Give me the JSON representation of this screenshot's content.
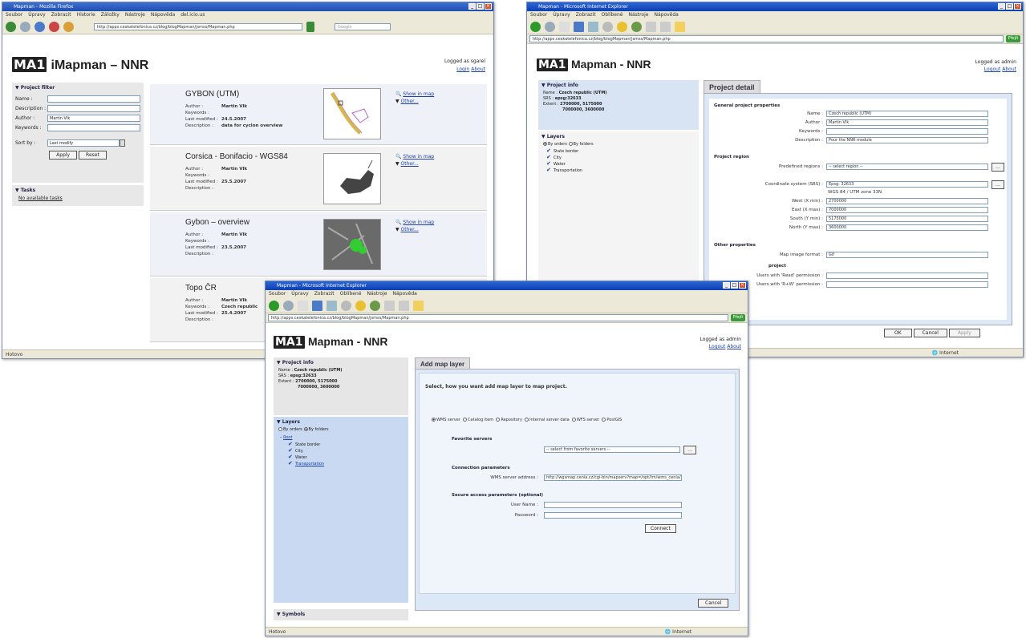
{
  "win1": {
    "title": "Mapman - Mozilla Firefox",
    "menu": [
      "Soubor",
      "Úpravy",
      "Zobrazit",
      "Historie",
      "Záložky",
      "Nástroje",
      "Nápověda",
      "del.icio.us"
    ],
    "address": "http://apps.ceskatelefonica.cz/blog/blogMapman/jsmss/Mapman.php",
    "search_placeholder": "Google",
    "app_title": "iMapman – NNR",
    "logo": "MA1",
    "logged_as": "Logged as  sgarel",
    "login": "Login",
    "about": "About",
    "filter": {
      "header": "Project filter",
      "name_label": "Name :",
      "description_label": "Description :",
      "author_label": "Author :",
      "author_value": "Martin Vlk",
      "keywords_label": "Keywords :",
      "sortby_label": "Sort by :",
      "sortby_value": "Last modify",
      "apply": "Apply",
      "reset": "Reset"
    },
    "tasks": {
      "header": "Tasks",
      "none": "No available tasks"
    },
    "projects": [
      {
        "title": "GYBON (UTM)",
        "author": "Martin Vlk",
        "keywords": "",
        "modified": "24.5.2007",
        "description": "data for cyclon overview"
      },
      {
        "title": "Corsica - Bonifacio - WGS84",
        "author": "Martin Vlk",
        "keywords": "",
        "modified": "25.5.2007",
        "description": ""
      },
      {
        "title": "Gybon – overview",
        "author": "Martin Vlk",
        "keywords": "",
        "modified": "23.5.2007",
        "description": ""
      },
      {
        "title": "Topo ČR",
        "author": "Martin Vlk",
        "keywords": "Czech republic",
        "modified": "25.4.2007",
        "description": ""
      }
    ],
    "meta_labels": {
      "author": "Author :",
      "keywords": "Keywords :",
      "modified": "Last modified :",
      "description": "Description :"
    },
    "show_map": "Show in map",
    "other": "Other...",
    "status": "Hotovo"
  },
  "win2": {
    "title": "Mapman - Microsoft Internet Explorer",
    "menu": [
      "Soubor",
      "Úpravy",
      "Zobrazit",
      "Oblíbené",
      "Nástroje",
      "Nápověda"
    ],
    "address": "http://apps.ceskatelefonica.cz/blog/blogMapman/jsmss/Mapman.php",
    "go": "Přejít",
    "app_title": "Mapman - NNR",
    "logo": "MA1",
    "logged_as": "Logged as  admin",
    "logout": "Logout",
    "about": "About",
    "info": {
      "header": "Project info",
      "name_label": "Name :",
      "name_value": "Czech republic (UTM)",
      "srs_label": "SRS :",
      "srs_value": "epsg:32633",
      "extent_label": "Extent :",
      "extent_value1": "2700000, 5175000",
      "extent_value2": "7000000, 3600000"
    },
    "layers": {
      "header": "Layers",
      "by_orders": "By orders",
      "by_folders": "By folders",
      "items": [
        "State border",
        "City",
        "Water",
        "Transportation"
      ]
    },
    "tab": "Project detail",
    "general": "General project properties",
    "fields": {
      "name_label": "Name :",
      "name_value": "Czech republic (UTM)",
      "author_label": "Author :",
      "author_value": "Martin Vlk",
      "keywords_label": "Keywords :",
      "keywords_value": "",
      "description_label": "Description :",
      "description_value": "Pour the NNR module"
    },
    "region": {
      "header": "Project region",
      "predefined_label": "Predefined regions :",
      "predefined_value": "-- select region --",
      "coord_label": "Coordinate system (SRS) :",
      "coord_value": "Epsg: 32633",
      "coord_desc": "WGS 84 / UTM zone 33N",
      "west_label": "West (X min) :",
      "west_value": "2700000",
      "east_label": "East (X max) :",
      "east_value": "7000000",
      "south_label": "South (Y min) :",
      "south_value": "5175000",
      "north_label": "North (Y max) :",
      "north_value": "3600000"
    },
    "other": {
      "header": "Other properties",
      "format_label": "Map image format :",
      "format_value": "Gif",
      "access_header": "project",
      "read_label": "Users with 'Read' permission :",
      "rw_label": "Users with 'R+W' permission :"
    },
    "ok": "OK",
    "cancel": "Cancel",
    "apply": "Apply",
    "status": "Internet"
  },
  "win3": {
    "title": "Mapman - Microsoft Internet Explorer",
    "menu": [
      "Soubor",
      "Úpravy",
      "Zobrazit",
      "Oblíbené",
      "Nástroje",
      "Nápověda"
    ],
    "address": "http://apps.ceskatelefonica.cz/blog/blogMapman/jsmss/Mapman.php",
    "go": "Přejít",
    "app_title": "Mapman - NNR",
    "logo": "MA1",
    "logged_as": "Logged as  admin",
    "logout": "Logout",
    "about": "About",
    "info": {
      "header": "Project info",
      "name_label": "Name :",
      "name_value": "Czech republic (UTM)",
      "srs_label": "SRS :",
      "srs_value": "epsg:32633",
      "extent_label": "Extent :",
      "extent_value1": "2700000, 5175000",
      "extent_value2": "7000000, 3600000"
    },
    "layers": {
      "header": "Layers",
      "by_orders": "By orders",
      "by_folders": "By folders",
      "root": "Root",
      "items": [
        "State border",
        "City",
        "Water",
        "Transportation"
      ]
    },
    "symbols": "Symbols",
    "tab": "Add map layer",
    "prompt": "Select, how you want add map layer to map project.",
    "sources": [
      "WMS server",
      "Catalog item",
      "Repository",
      "Internal server data",
      "WFS server",
      "PostGIS"
    ],
    "favorite": {
      "header": "Favorite servers",
      "value": "-- select from favorite servers --"
    },
    "connection": {
      "header": "Connection parameters",
      "url_label": "WMS server address :",
      "url_value": "http://wgsmap.cenia.cz/cgi-bin/mapserv?map=/opt/tm/wms_cenia/..."
    },
    "secure": {
      "header": "Secure access parameters (optional)",
      "user_label": "User Name :",
      "password_label": "Password :"
    },
    "connect": "Connect",
    "cancel": "Cancel",
    "status_left": "Hotovo",
    "status_right": "Internet"
  }
}
